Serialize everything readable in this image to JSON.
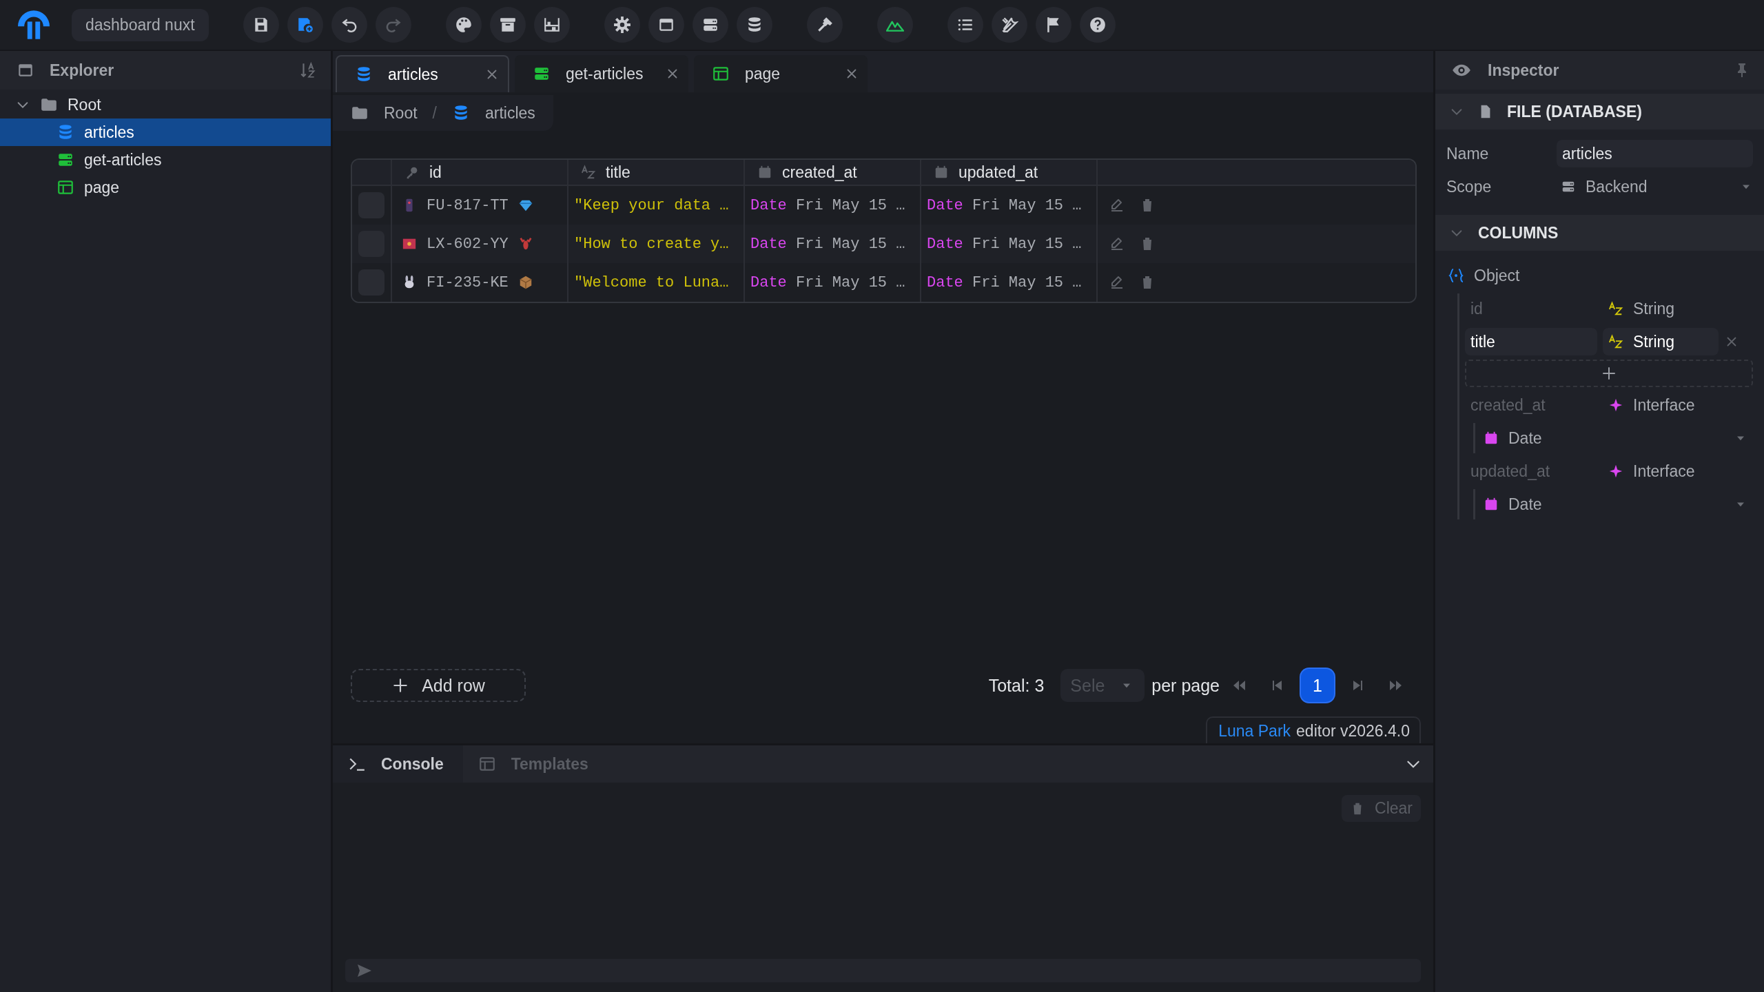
{
  "app": {
    "project": "dashboard nuxt"
  },
  "explorer": {
    "title": "Explorer",
    "tree": [
      {
        "label": "Root",
        "kind": "folder",
        "expanded": true,
        "selected": false,
        "children": [
          {
            "label": "articles",
            "kind": "database",
            "selected": true
          },
          {
            "label": "get-articles",
            "kind": "api",
            "selected": false
          },
          {
            "label": "page",
            "kind": "page",
            "selected": false
          }
        ]
      }
    ]
  },
  "tabs": [
    {
      "label": "articles",
      "kind": "database",
      "selected": true
    },
    {
      "label": "get-articles",
      "kind": "api",
      "selected": false
    },
    {
      "label": "page",
      "kind": "page",
      "selected": false
    }
  ],
  "breadcrumb": {
    "separator": "/",
    "items": [
      {
        "label": "Root",
        "kind": "folder"
      },
      {
        "label": "articles",
        "kind": "database"
      }
    ]
  },
  "table": {
    "columns": [
      {
        "label": "id",
        "kind": "key"
      },
      {
        "label": "title",
        "kind": "string"
      },
      {
        "label": "created_at",
        "kind": "date"
      },
      {
        "label": "updated_at",
        "kind": "date"
      }
    ],
    "rows": [
      {
        "checked": false,
        "id": "FU-817-TT",
        "title": "\"Keep your data …",
        "created_at": {
          "type": "Date",
          "value": "Fri May 15 …"
        },
        "updated_at": {
          "type": "Date",
          "value": "Fri May 15 …"
        }
      },
      {
        "checked": false,
        "id": "LX-602-YY",
        "title": "\"How to create y…",
        "created_at": {
          "type": "Date",
          "value": "Fri May 15 …"
        },
        "updated_at": {
          "type": "Date",
          "value": "Fri May 15 …"
        }
      },
      {
        "checked": false,
        "id": "FI-235-KE",
        "title": "\"Welcome to Luna…",
        "created_at": {
          "type": "Date",
          "value": "Fri May 15 …"
        },
        "updated_at": {
          "type": "Date",
          "value": "Fri May 15 …"
        }
      }
    ]
  },
  "add_row": "Add row",
  "pagination": {
    "total": "Total: 3",
    "page_size": {
      "placeholder": "Sele"
    },
    "per_page": "per page",
    "pages": [
      {
        "label": "1",
        "selected": true
      }
    ]
  },
  "footer": {
    "link": "Luna Park",
    "text": "editor v2026.4.0"
  },
  "bottom_panel": {
    "tabs": [
      {
        "label": "Console",
        "kind": "console",
        "selected": true
      },
      {
        "label": "Templates",
        "kind": "templates",
        "selected": false
      }
    ],
    "clear": "Clear"
  },
  "inspector": {
    "title": "Inspector",
    "file_section": {
      "title": "FILE (DATABASE)",
      "expanded": true,
      "fields": [
        {
          "label": "Name",
          "kind": "input",
          "value": "articles"
        },
        {
          "label": "Scope",
          "kind": "select",
          "value": "Backend"
        }
      ]
    },
    "columns_section": {
      "title": "COLUMNS",
      "expanded": true,
      "root": "Object",
      "fields": [
        {
          "name": "id",
          "kind": "string",
          "type": "String",
          "editing": false
        },
        {
          "name": "title",
          "kind": "string",
          "type": "String",
          "editing": true
        },
        {
          "name": "created_at",
          "kind": "interface",
          "type": "Interface",
          "child": "Date"
        },
        {
          "name": "updated_at",
          "kind": "interface",
          "type": "Interface",
          "child": "Date"
        }
      ]
    }
  }
}
